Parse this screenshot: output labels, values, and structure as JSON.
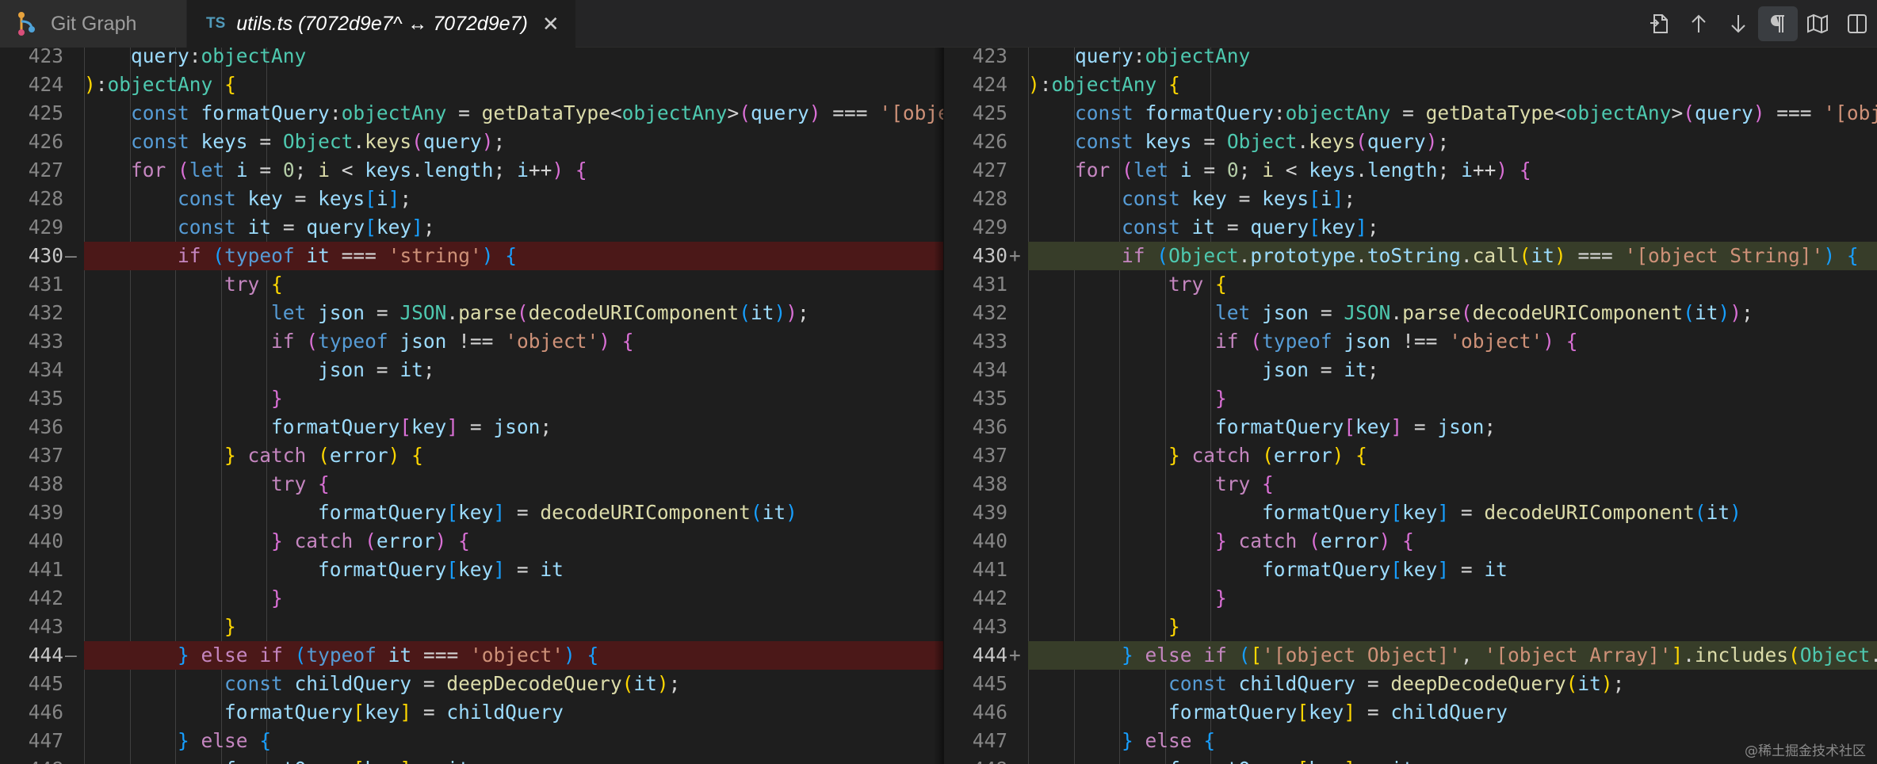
{
  "tabs": {
    "git_graph": "Git Graph",
    "ts_badge": "TS",
    "active_title": "utils.ts (7072d9e7^ ↔ 7072d9e7)",
    "close": "✕"
  },
  "actions": [
    "open-file",
    "previous-change",
    "next-change",
    "toggle-whitespace",
    "open-changes-only",
    "split-editor"
  ],
  "colors": {
    "deleted_line": "#4b1818",
    "inserted_line": "#373d29",
    "keyword": "#569cd6",
    "control": "#c586c0",
    "variable": "#9cdcfe",
    "type": "#4ec9b0",
    "function": "#dcdcaa",
    "string": "#ce9178"
  },
  "left": {
    "lines": [
      {
        "n": "423",
        "m": "",
        "code": "    query:objectAny"
      },
      {
        "n": "424",
        "m": "",
        "code": "):objectAny {"
      },
      {
        "n": "425",
        "m": "",
        "code": "    const formatQuery:objectAny = getDataType<objectAny>(query) === '[object Object]' ? {} : []"
      },
      {
        "n": "426",
        "m": "",
        "code": "    const keys = Object.keys(query);"
      },
      {
        "n": "427",
        "m": "",
        "code": "    for (let i = 0; i < keys.length; i++) {"
      },
      {
        "n": "428",
        "m": "",
        "code": "        const key = keys[i];"
      },
      {
        "n": "429",
        "m": "",
        "code": "        const it = query[key];"
      },
      {
        "n": "430",
        "m": "—",
        "code": "        if (typeof it === 'string') {"
      },
      {
        "n": "431",
        "m": "",
        "code": "            try {"
      },
      {
        "n": "432",
        "m": "",
        "code": "                let json = JSON.parse(decodeURIComponent(it));"
      },
      {
        "n": "433",
        "m": "",
        "code": "                if (typeof json !== 'object') {"
      },
      {
        "n": "434",
        "m": "",
        "code": "                    json = it;"
      },
      {
        "n": "435",
        "m": "",
        "code": "                }"
      },
      {
        "n": "436",
        "m": "",
        "code": "                formatQuery[key] = json;"
      },
      {
        "n": "437",
        "m": "",
        "code": "            } catch (error) {"
      },
      {
        "n": "438",
        "m": "",
        "code": "                try {"
      },
      {
        "n": "439",
        "m": "",
        "code": "                    formatQuery[key] = decodeURIComponent(it)"
      },
      {
        "n": "440",
        "m": "",
        "code": "                } catch (error) {"
      },
      {
        "n": "441",
        "m": "",
        "code": "                    formatQuery[key] = it"
      },
      {
        "n": "442",
        "m": "",
        "code": "                }"
      },
      {
        "n": "443",
        "m": "",
        "code": "            }"
      },
      {
        "n": "444",
        "m": "—",
        "code": "        } else if (typeof it === 'object') {"
      },
      {
        "n": "445",
        "m": "",
        "code": "            const childQuery = deepDecodeQuery(it);"
      },
      {
        "n": "446",
        "m": "",
        "code": "            formatQuery[key] = childQuery"
      },
      {
        "n": "447",
        "m": "",
        "code": "        } else {"
      },
      {
        "n": "448",
        "m": "",
        "code": "            formatQuery[key] = it"
      }
    ]
  },
  "right": {
    "lines": [
      {
        "n": "423",
        "m": "",
        "code": "    query:objectAny"
      },
      {
        "n": "424",
        "m": "",
        "code": "):objectAny {"
      },
      {
        "n": "425",
        "m": "",
        "code": "    const formatQuery:objectAny = getDataType<objectAny>(query) === '[object Object]' ? {} : []"
      },
      {
        "n": "426",
        "m": "",
        "code": "    const keys = Object.keys(query);"
      },
      {
        "n": "427",
        "m": "",
        "code": "    for (let i = 0; i < keys.length; i++) {"
      },
      {
        "n": "428",
        "m": "",
        "code": "        const key = keys[i];"
      },
      {
        "n": "429",
        "m": "",
        "code": "        const it = query[key];"
      },
      {
        "n": "430",
        "m": "+",
        "code": "        if (Object.prototype.toString.call(it) === '[object String]') {"
      },
      {
        "n": "431",
        "m": "",
        "code": "            try {"
      },
      {
        "n": "432",
        "m": "",
        "code": "                let json = JSON.parse(decodeURIComponent(it));"
      },
      {
        "n": "433",
        "m": "",
        "code": "                if (typeof json !== 'object') {"
      },
      {
        "n": "434",
        "m": "",
        "code": "                    json = it;"
      },
      {
        "n": "435",
        "m": "",
        "code": "                }"
      },
      {
        "n": "436",
        "m": "",
        "code": "                formatQuery[key] = json;"
      },
      {
        "n": "437",
        "m": "",
        "code": "            } catch (error) {"
      },
      {
        "n": "438",
        "m": "",
        "code": "                try {"
      },
      {
        "n": "439",
        "m": "",
        "code": "                    formatQuery[key] = decodeURIComponent(it)"
      },
      {
        "n": "440",
        "m": "",
        "code": "                } catch (error) {"
      },
      {
        "n": "441",
        "m": "",
        "code": "                    formatQuery[key] = it"
      },
      {
        "n": "442",
        "m": "",
        "code": "                }"
      },
      {
        "n": "443",
        "m": "",
        "code": "            }"
      },
      {
        "n": "444",
        "m": "+",
        "code": "        } else if (['[object Object]', '[object Array]'].includes(Object.prototype.toString.call(it))) {"
      },
      {
        "n": "445",
        "m": "",
        "code": "            const childQuery = deepDecodeQuery(it);"
      },
      {
        "n": "446",
        "m": "",
        "code": "            formatQuery[key] = childQuery"
      },
      {
        "n": "447",
        "m": "",
        "code": "        } else {"
      },
      {
        "n": "448",
        "m": "",
        "code": "            formatQuery[key] = it"
      }
    ]
  },
  "watermark": "@稀土掘金技术社区"
}
